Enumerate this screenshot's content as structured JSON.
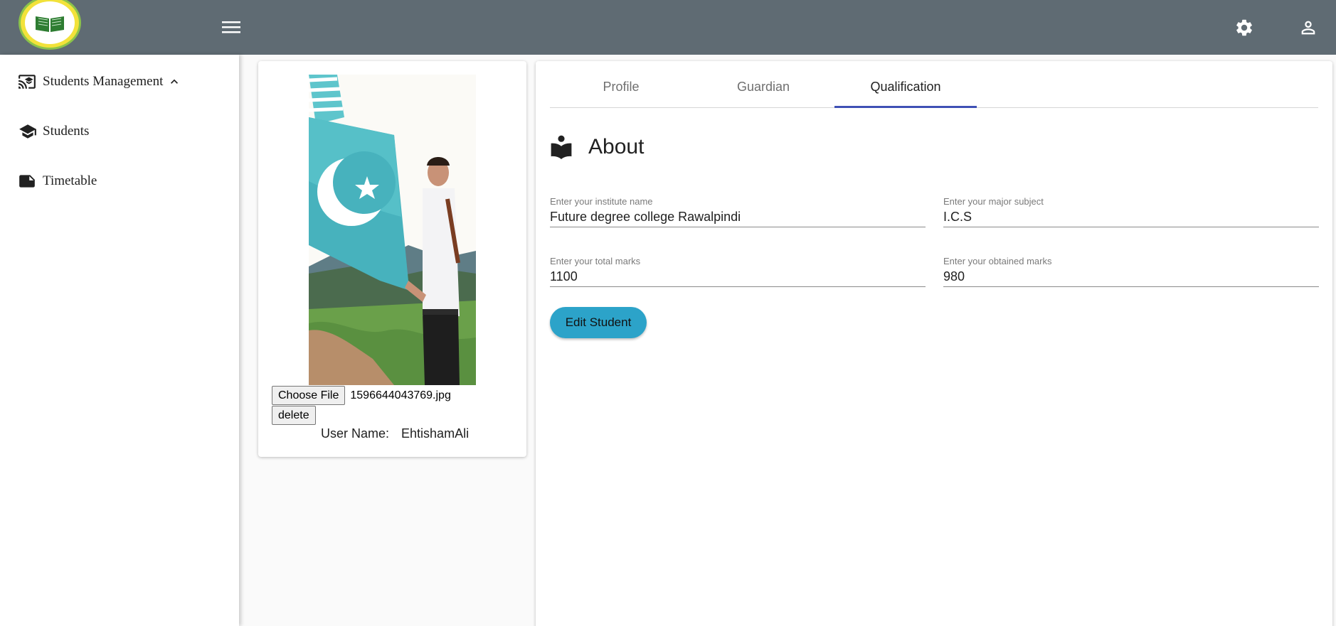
{
  "header": {
    "brand_color": "#5f6b73",
    "logo": "school-logo-icon",
    "menu_icon": "menu-icon",
    "settings_icon": "gear-icon",
    "account_icon": "account-icon"
  },
  "sidebar": {
    "items": [
      {
        "label": "Students Management",
        "icon": "cast-for-education-icon",
        "expanded": true
      },
      {
        "label": "Students",
        "icon": "graduation-cap-icon"
      },
      {
        "label": "Timetable",
        "icon": "note-icon"
      }
    ]
  },
  "profile": {
    "photo_icon": "profile-photo",
    "choose_file_label": "Choose File",
    "file_name": "1596644043769.jpg",
    "delete_label": "delete",
    "user_name_label": "User Name:",
    "user_name_value": "EhtishamAli"
  },
  "tabs": [
    {
      "label": "Profile",
      "active": false
    },
    {
      "label": "Guardian",
      "active": false
    },
    {
      "label": "Qualification",
      "active": true
    }
  ],
  "accent_color": "#3f51b5",
  "section": {
    "title": "About",
    "icon": "book-reader-icon"
  },
  "form": {
    "institute": {
      "label": "Enter your institute name",
      "value": "Future degree college Rawalpindi"
    },
    "major": {
      "label": "Enter your major subject",
      "value": "I.C.S"
    },
    "total": {
      "label": "Enter your total marks",
      "value": "1100"
    },
    "obtained": {
      "label": "Enter your obtained marks",
      "value": "980"
    }
  },
  "edit_button": {
    "label": "Edit Student",
    "color": "#2ca3c9"
  }
}
